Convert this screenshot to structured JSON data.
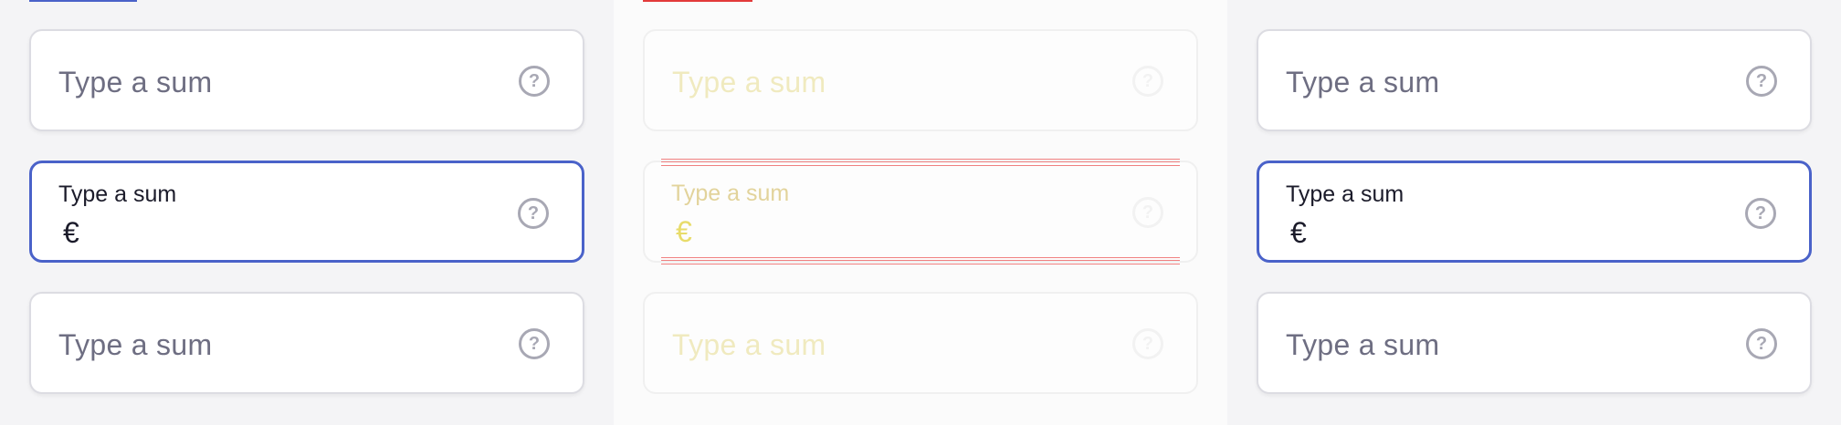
{
  "colors": {
    "accent": "#4a62c9",
    "error_indicator": "#e23a3a",
    "border": "#dcdce2",
    "placeholder": "#6e6e82",
    "help_icon": "#a8a8b4"
  },
  "panels": [
    {
      "fields": [
        {
          "placeholder": "Type a sum",
          "state": "default",
          "icon": "help-icon"
        },
        {
          "label": "Type a sum",
          "currency": "€",
          "state": "focused",
          "icon": "help-icon"
        },
        {
          "placeholder": "Type a sum",
          "state": "default",
          "icon": "help-icon"
        }
      ]
    },
    {
      "fields": [
        {
          "placeholder": "Type a sum",
          "state": "faded",
          "icon": "help-icon"
        },
        {
          "label": "Type a sum",
          "currency": "€",
          "state": "faded-focused",
          "icon": "help-icon"
        },
        {
          "placeholder": "Type a sum",
          "state": "faded",
          "icon": "help-icon"
        }
      ]
    },
    {
      "fields": [
        {
          "placeholder": "Type a sum",
          "state": "default",
          "icon": "help-icon"
        },
        {
          "label": "Type a sum",
          "currency": "€",
          "state": "focused",
          "icon": "help-icon"
        },
        {
          "placeholder": "Type a sum",
          "state": "default",
          "icon": "help-icon"
        }
      ]
    }
  ],
  "help_glyph": "?"
}
